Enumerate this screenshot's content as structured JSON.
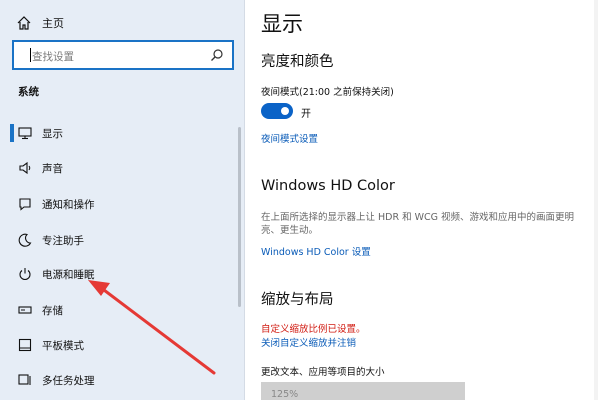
{
  "sidebar": {
    "home_label": "主页",
    "search_placeholder": "查找设置",
    "section_label": "系统",
    "items": [
      {
        "label": "显示",
        "icon": "monitor-icon",
        "active": true
      },
      {
        "label": "声音",
        "icon": "speaker-icon",
        "active": false
      },
      {
        "label": "通知和操作",
        "icon": "notification-icon",
        "active": false
      },
      {
        "label": "专注助手",
        "icon": "moon-icon",
        "active": false
      },
      {
        "label": "电源和睡眠",
        "icon": "power-icon",
        "active": false
      },
      {
        "label": "存储",
        "icon": "storage-icon",
        "active": false
      },
      {
        "label": "平板模式",
        "icon": "tablet-icon",
        "active": false
      },
      {
        "label": "多任务处理",
        "icon": "multitask-icon",
        "active": false
      }
    ]
  },
  "main": {
    "title": "显示",
    "brightness": {
      "heading": "亮度和颜色",
      "night_mode_label": "夜间模式(21:00 之前保持关闭)",
      "toggle_state": "开",
      "night_mode_settings_link": "夜间模式设置"
    },
    "hdr": {
      "heading": "Windows HD Color",
      "description": "在上面所选择的显示器上让 HDR 和 WCG 视频、游戏和应用中的画面更明亮、更生动。",
      "settings_link": "Windows HD Color 设置"
    },
    "scale": {
      "heading": "缩放与布局",
      "custom_scale_notice": "自定义缩放比例已设置。",
      "disable_link": "关闭自定义缩放并注销",
      "text_size_label": "更改文本、应用等项目的大小",
      "scale_value": "125%"
    }
  },
  "colors": {
    "accent": "#1a73c6",
    "link": "#0b5cb8",
    "warning": "#d11b12",
    "sidebar_bg": "#e6edf6",
    "annotation_arrow": "#e53935"
  }
}
